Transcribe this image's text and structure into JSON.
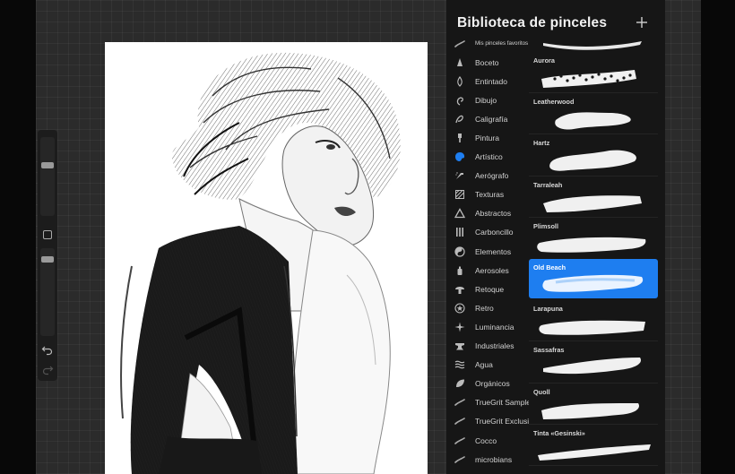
{
  "panel": {
    "title": "Biblioteca de pinceles",
    "add_icon": "plus-icon",
    "accent": "#1e7ef0"
  },
  "categories": [
    {
      "label": "Mis pinceles favoritos",
      "icon": "brush-stroke-icon"
    },
    {
      "label": "Boceto",
      "icon": "pencil-tip-icon"
    },
    {
      "label": "Entintado",
      "icon": "ink-drop-icon"
    },
    {
      "label": "Dibujo",
      "icon": "swirl-icon"
    },
    {
      "label": "Caligrafía",
      "icon": "calligraphy-icon"
    },
    {
      "label": "Pintura",
      "icon": "paintbrush-icon"
    },
    {
      "label": "Artístico",
      "icon": "palette-icon"
    },
    {
      "label": "Aerógrafo",
      "icon": "airbrush-icon"
    },
    {
      "label": "Texturas",
      "icon": "texture-icon"
    },
    {
      "label": "Abstractos",
      "icon": "triangle-icon"
    },
    {
      "label": "Carboncillo",
      "icon": "charcoal-icon"
    },
    {
      "label": "Elementos",
      "icon": "yin-yang-icon"
    },
    {
      "label": "Aerosoles",
      "icon": "spray-can-icon"
    },
    {
      "label": "Retoque",
      "icon": "mushroom-icon"
    },
    {
      "label": "Retro",
      "icon": "star-badge-icon"
    },
    {
      "label": "Luminancia",
      "icon": "sparkle-icon"
    },
    {
      "label": "Industriales",
      "icon": "anvil-icon"
    },
    {
      "label": "Agua",
      "icon": "waves-icon"
    },
    {
      "label": "Orgánicos",
      "icon": "leaf-icon"
    },
    {
      "label": "TrueGrit Sampler",
      "icon": "brush-stroke-icon"
    },
    {
      "label": "TrueGrit Exclusives",
      "icon": "brush-stroke-icon"
    },
    {
      "label": "Cocco",
      "icon": "brush-stroke-icon"
    },
    {
      "label": "microbians",
      "icon": "brush-stroke-icon"
    }
  ],
  "active_category": "Artístico",
  "brushes": [
    {
      "name": "Aurora"
    },
    {
      "name": "Leatherwood"
    },
    {
      "name": "Hartz"
    },
    {
      "name": "Tarraleah"
    },
    {
      "name": "Plimsoll"
    },
    {
      "name": "Old Beach"
    },
    {
      "name": "Larapuna"
    },
    {
      "name": "Sassafras"
    },
    {
      "name": "Quoll"
    },
    {
      "name": "Tinta «Gesinski»"
    }
  ],
  "selected_brush": "Old Beach",
  "sidebar": {
    "brush_size_level": 0.65,
    "opacity_level": 0.1,
    "modify_icon": "square-icon",
    "undo_icon": "undo-icon",
    "redo_icon": "redo-icon"
  },
  "canvas": {
    "content_icon": "portrait-sketch-image"
  }
}
